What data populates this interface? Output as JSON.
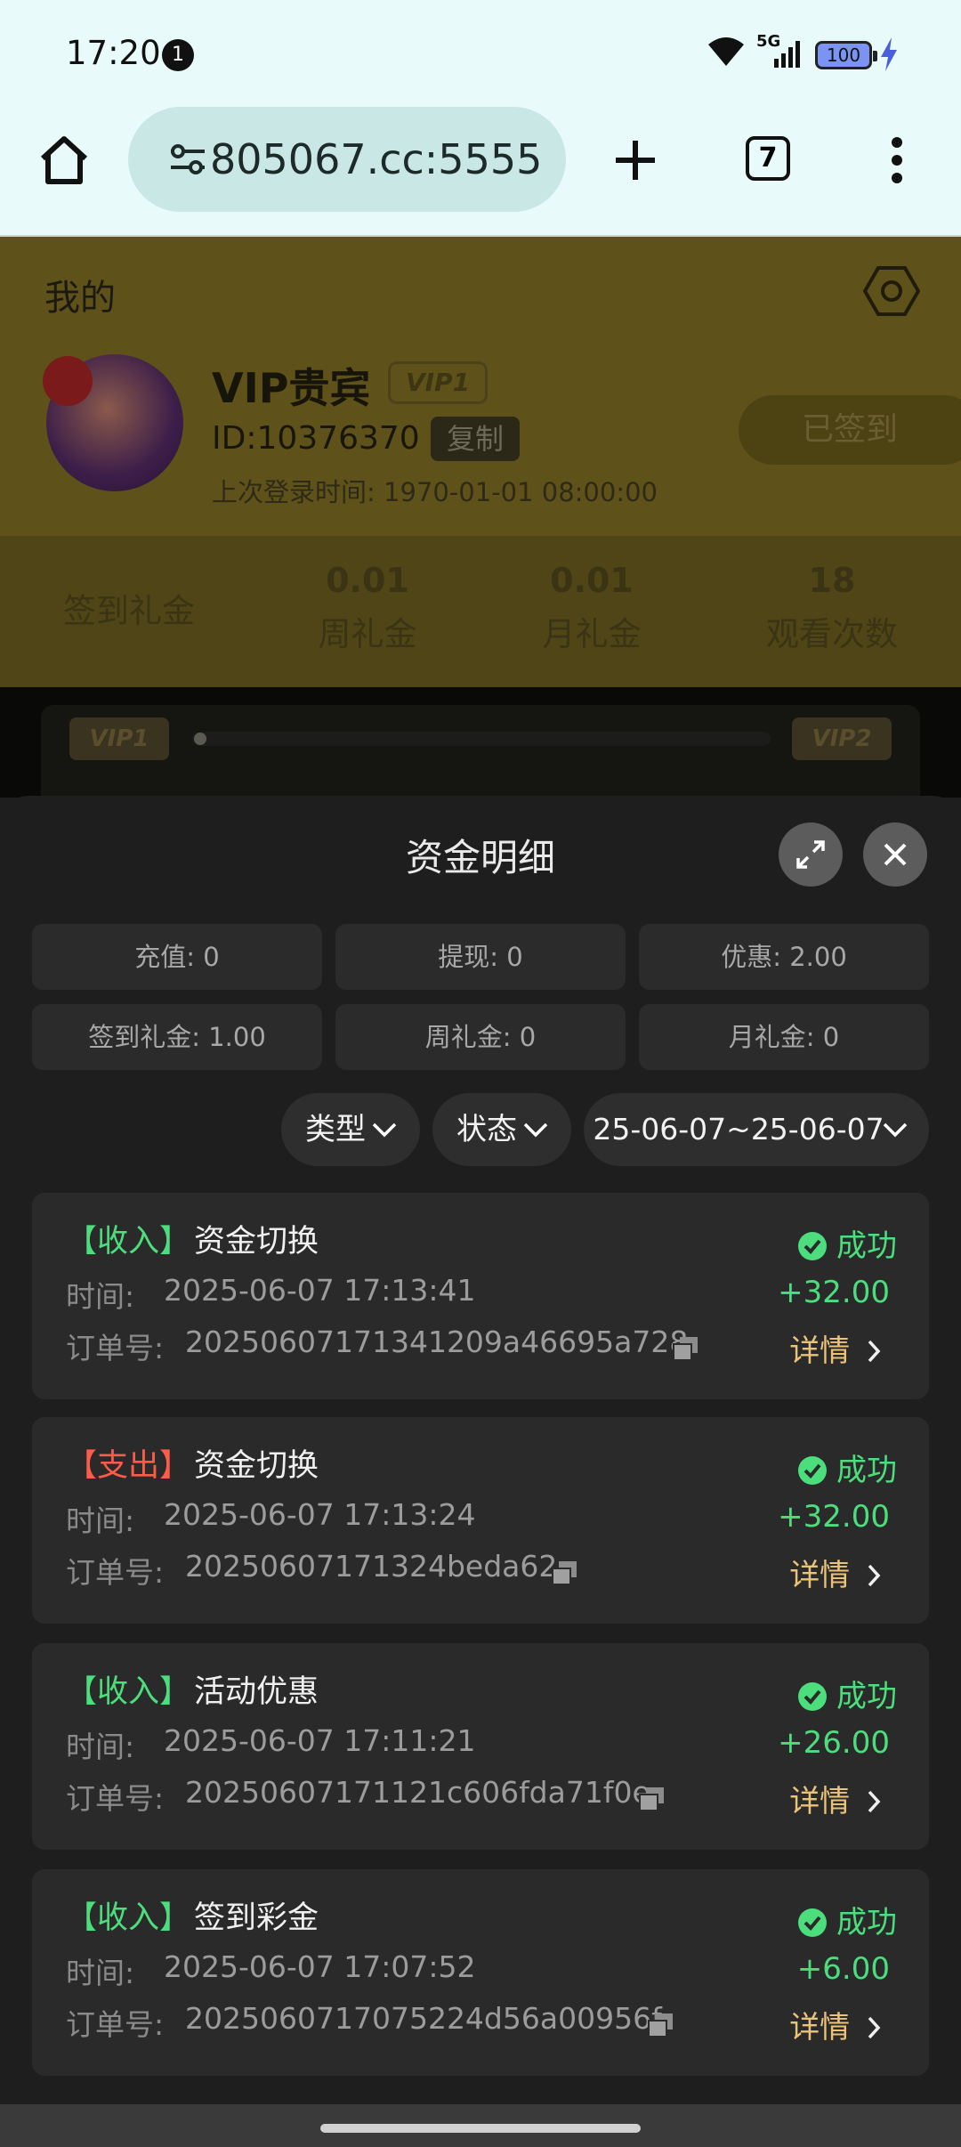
{
  "status_bar": {
    "time": "17:20",
    "notification_count": "1",
    "network": "5G",
    "battery": "100"
  },
  "browser": {
    "url": "805067.cc:5555",
    "tab_count": "7"
  },
  "profile": {
    "title": "我的",
    "vip_name": "VIP贵宾",
    "vip_level": "VIP1",
    "user_id": "ID:10376370",
    "copy_label": "复制",
    "last_login": "上次登录时间:   1970-01-01 08:00:00",
    "signed_label": "已签到",
    "stats": [
      {
        "value": "",
        "label": "签到礼金"
      },
      {
        "value": "0.01",
        "label": "周礼金"
      },
      {
        "value": "0.01",
        "label": "月礼金"
      },
      {
        "value": "18",
        "label": "观看次数"
      }
    ],
    "vip_from": "VIP1",
    "vip_to": "VIP2"
  },
  "sheet": {
    "title": "资金明细",
    "summary": [
      "充值: 0",
      "提现: 0",
      "优惠: 2.00",
      "签到礼金: 1.00",
      "周礼金: 0",
      "月礼金: 0"
    ],
    "filters": {
      "type": "类型",
      "status": "状态",
      "date_range": "25-06-07~25-06-07"
    },
    "time_label": "时间:",
    "order_label": "订单号:",
    "detail_label": "详情",
    "records": [
      {
        "direction": "【收入】",
        "direction_color": "#4cde7c",
        "name": "资金切换",
        "time": "2025-06-07 17:13:41",
        "order": "20250607171341209a46695a728",
        "status": "成功",
        "amount": "+32.00"
      },
      {
        "direction": "【支出】",
        "direction_color": "#ff5b4a",
        "name": "资金切换",
        "time": "2025-06-07 17:13:24",
        "order": "20250607171324beda62",
        "status": "成功",
        "amount": "+32.00"
      },
      {
        "direction": "【收入】",
        "direction_color": "#4cde7c",
        "name": "活动优惠",
        "time": "2025-06-07 17:11:21",
        "order": "20250607171121c606fda71f0e",
        "status": "成功",
        "amount": "+26.00"
      },
      {
        "direction": "【收入】",
        "direction_color": "#4cde7c",
        "name": "签到彩金",
        "time": "2025-06-07 17:07:52",
        "order": "2025060717075224d56a00956f",
        "status": "成功",
        "amount": "+6.00"
      }
    ]
  }
}
